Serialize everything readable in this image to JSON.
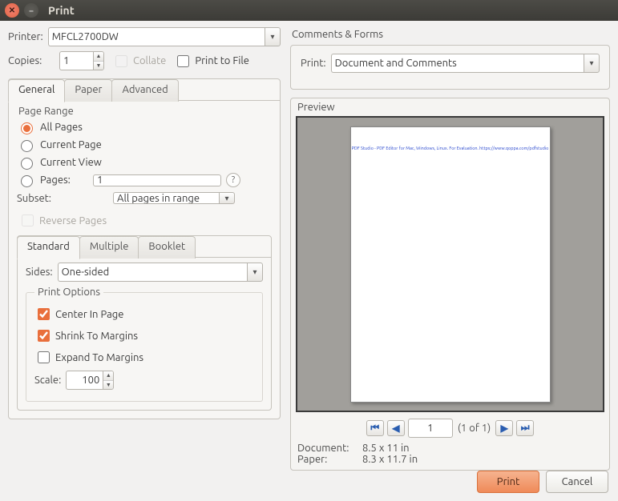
{
  "window": {
    "title": "Print"
  },
  "printer": {
    "label": "Printer:",
    "value": "MFCL2700DW",
    "copies_label": "Copies:",
    "copies_value": "1",
    "collate_label": "Collate",
    "print_to_file_label": "Print to File"
  },
  "tabs": {
    "general": "General",
    "paper": "Paper",
    "advanced": "Advanced"
  },
  "page_range": {
    "legend": "Page Range",
    "all": "All Pages",
    "current_page": "Current Page",
    "current_view": "Current View",
    "pages_label": "Pages:",
    "pages_value": "1",
    "subset_label": "Subset:",
    "subset_value": "All pages in range",
    "reverse_label": "Reverse Pages"
  },
  "layout_tabs": {
    "standard": "Standard",
    "multiple": "Multiple",
    "booklet": "Booklet"
  },
  "sides": {
    "label": "Sides:",
    "value": "One-sided"
  },
  "print_options": {
    "legend": "Print Options",
    "center": "Center In Page",
    "shrink": "Shrink To Margins",
    "expand": "Expand To Margins",
    "scale_label": "Scale:",
    "scale_value": "100"
  },
  "comments": {
    "title": "Comments & Forms",
    "print_label": "Print:",
    "value": "Document and Comments"
  },
  "preview": {
    "title": "Preview",
    "watermark": "PDF Studio - PDF Editor for Mac, Windows, Linux. For Evaluation. https://www.qoppa.com/pdfstudio",
    "page_value": "1",
    "of_text": "(1 of 1)",
    "doc_label": "Document:",
    "doc_value": "8.5 x 11 in",
    "paper_label": "Paper:",
    "paper_value": "8.3 x 11.7 in"
  },
  "footer": {
    "print": "Print",
    "cancel": "Cancel"
  }
}
